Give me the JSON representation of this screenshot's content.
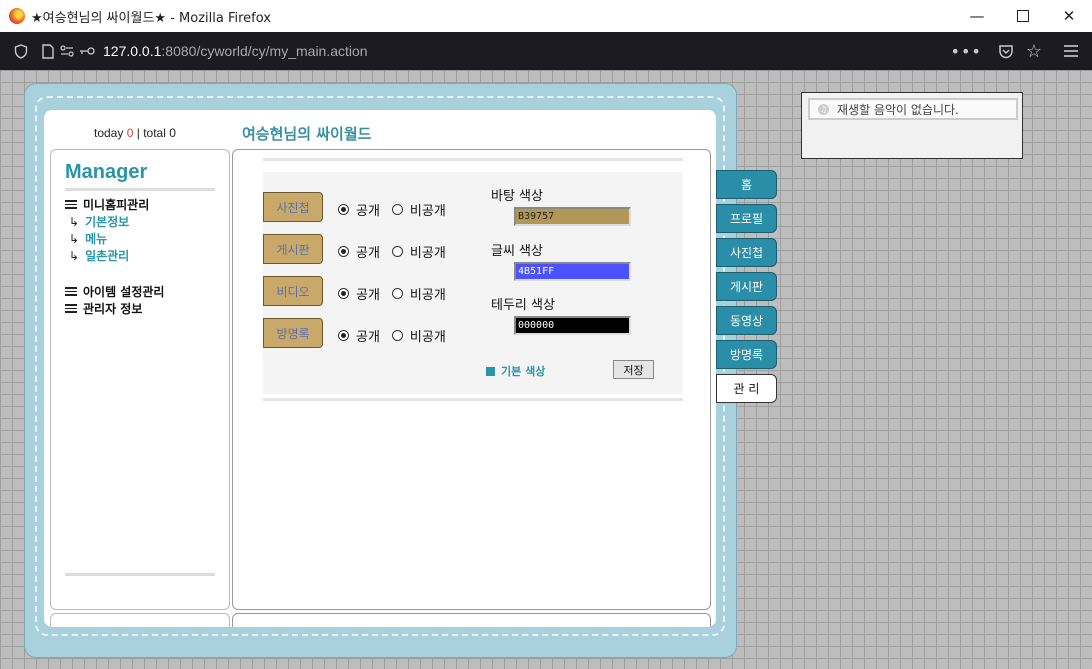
{
  "window": {
    "title": "★여승현님의 싸이월드★ - Mozilla Firefox",
    "url_host": "127.0.0.1",
    "url_rest": ":8080/cyworld/cy/my_main.action"
  },
  "header": {
    "today_label": "today",
    "today_count": "0",
    "separator": "|",
    "total_label": "total 0",
    "site_title": "여승현님의 싸이월드"
  },
  "sidebar": {
    "title": "Manager",
    "groups": [
      {
        "label": "미니홈피관리",
        "items": [
          "기본정보",
          "메뉴",
          "일촌관리"
        ]
      },
      {
        "label": "아이템 설정관리"
      },
      {
        "label": "관리자 정보"
      }
    ],
    "arrow": "↳"
  },
  "menu_settings": {
    "rows": [
      {
        "label": "사진첩",
        "public": "공개",
        "private": "비공개",
        "selected": "public"
      },
      {
        "label": "게시판",
        "public": "공개",
        "private": "비공개",
        "selected": "public"
      },
      {
        "label": "비디오",
        "public": "공개",
        "private": "비공개",
        "selected": "public"
      },
      {
        "label": "방명록",
        "public": "공개",
        "private": "비공개",
        "selected": "public"
      }
    ],
    "background_color": {
      "label": "바탕 색상",
      "value": "B39757",
      "color": "#b39757"
    },
    "text_color": {
      "label": "글씨 색상",
      "value": "4B51FF",
      "color": "#4b51ff"
    },
    "border_color": {
      "label": "테두리 색상",
      "value": "000000",
      "color": "#000000"
    },
    "default_color_label": "기본 색상",
    "save_label": "저장"
  },
  "tabs": [
    "홈",
    "프로필",
    "사진첩",
    "게시판",
    "동영상",
    "방명록",
    "관 리"
  ],
  "active_tab": "관 리",
  "music": {
    "status": "재생할 음악이 없습니다."
  },
  "colors": {
    "accent": "#2a95aa",
    "tab": "#2b8ea8",
    "book": "#a9d1dd",
    "category_button": "#c9a96a"
  }
}
